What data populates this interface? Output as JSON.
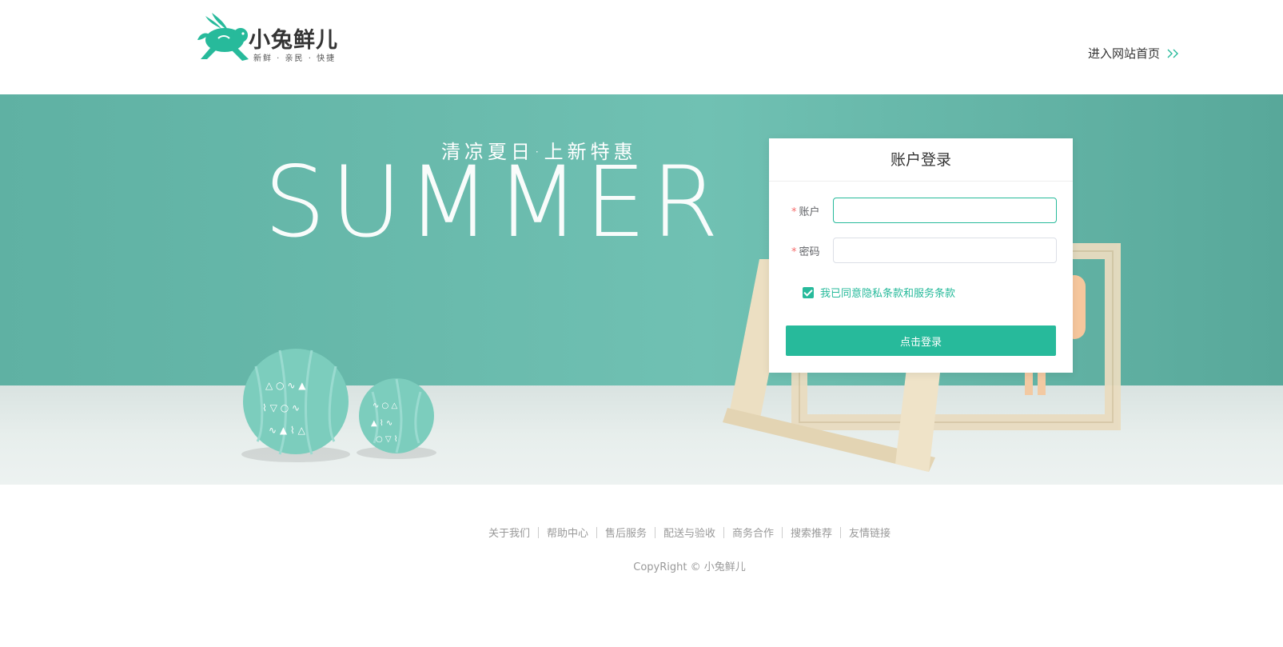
{
  "brand": {
    "name": "小兔鲜儿",
    "slogan": "新鲜 · 亲民 · 快捷",
    "accent_color": "#27ba9b"
  },
  "header": {
    "home_link": "进入网站首页",
    "home_icon": "double-chevron-right-icon"
  },
  "banner": {
    "subtitle": "清凉夏日·上新特惠",
    "title": "SUMMER"
  },
  "login": {
    "title": "账户登录",
    "account_label": "账户",
    "password_label": "密码",
    "account_value": "",
    "password_value": "",
    "agree_text": "我已同意隐私条款和服务条款",
    "agree_checked": true,
    "submit_label": "点击登录"
  },
  "footer": {
    "links": [
      "关于我们",
      "帮助中心",
      "售后服务",
      "配送与验收",
      "商务合作",
      "搜索推荐",
      "友情链接"
    ],
    "copyright": "CopyRight © 小兔鲜儿"
  }
}
